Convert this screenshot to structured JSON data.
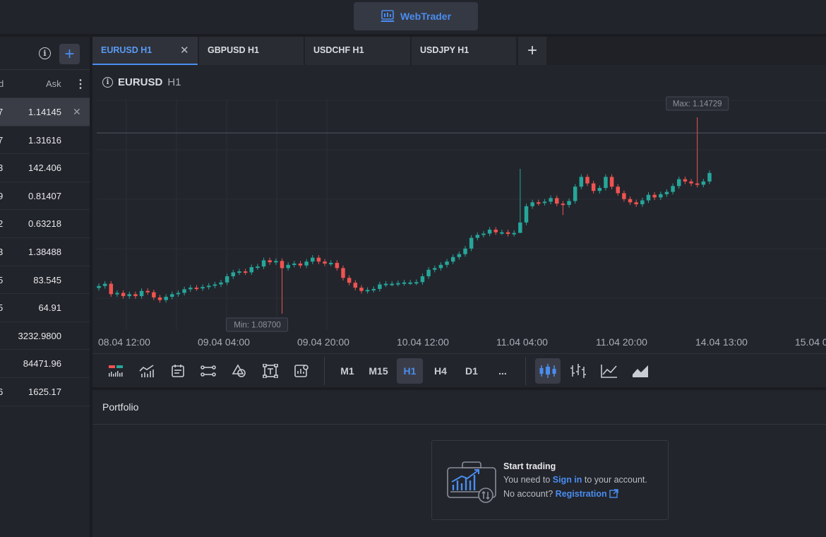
{
  "header": {
    "app_button_label": "WebTrader"
  },
  "watchlist": {
    "columns": {
      "bid": "d",
      "ask": "Ask"
    },
    "rows": [
      {
        "bid_tail": "7",
        "ask": "1.14145",
        "selected": true
      },
      {
        "bid_tail": "7",
        "ask": "1.31616"
      },
      {
        "bid_tail": "3",
        "ask": "142.406"
      },
      {
        "bid_tail": "9",
        "ask": "0.81407"
      },
      {
        "bid_tail": "2",
        "ask": "0.63218"
      },
      {
        "bid_tail": "3",
        "ask": "1.38488"
      },
      {
        "bid_tail": "5",
        "ask": "83.545"
      },
      {
        "bid_tail": "5",
        "ask": "64.91"
      },
      {
        "bid_tail": ".",
        "ask": "3232.9800"
      },
      {
        "bid_tail": ".",
        "ask": "84471.96"
      },
      {
        "bid_tail": "6",
        "ask": "1625.17"
      }
    ]
  },
  "tabs": [
    {
      "label": "EURUSD H1",
      "active": true
    },
    {
      "label": "GBPUSD H1"
    },
    {
      "label": "USDCHF H1"
    },
    {
      "label": "USDJPY H1"
    }
  ],
  "chart_header": {
    "symbol": "EURUSD",
    "timeframe": "H1"
  },
  "timeframes": [
    "M1",
    "M15",
    "H1",
    "H4",
    "D1",
    "..."
  ],
  "selected_timeframe": "H1",
  "chart_types": [
    "candlestick-icon",
    "ohlc-bars-icon",
    "line-chart-icon",
    "area-chart-icon"
  ],
  "colors": {
    "up": "#26a69a",
    "down": "#ef5350",
    "accent": "#4a8df0"
  },
  "chart_data": {
    "type": "candlestick",
    "symbol": "EURUSD",
    "timeframe": "H1",
    "x_tick_labels": [
      "08.04 12:00",
      "09.04 04:00",
      "09.04 20:00",
      "10.04 12:00",
      "11.04 04:00",
      "11.04 20:00",
      "14.04 13:00",
      "15.04 0"
    ],
    "max_label": "Max: 1.14729",
    "min_label": "Min: 1.08700",
    "max": 1.14729,
    "min": 1.087,
    "current_price_line": 1.1425,
    "close": [
      1.0955,
      1.0962,
      1.093,
      1.0934,
      1.0924,
      1.093,
      1.0924,
      1.094,
      1.0936,
      1.092,
      1.0912,
      1.0922,
      1.093,
      1.0934,
      1.0945,
      1.095,
      1.0948,
      1.0952,
      1.0956,
      1.096,
      1.0966,
      1.0985,
      1.0997,
      1.1,
      1.0997,
      1.1013,
      1.1015,
      1.1034,
      1.1028,
      1.1032,
      1.101,
      1.102,
      1.1024,
      1.1018,
      1.103,
      1.1042,
      1.103,
      1.1024,
      1.1026,
      1.101,
      1.098,
      1.0965,
      1.095,
      1.094,
      1.0943,
      1.0946,
      1.096,
      1.0962,
      1.0962,
      1.0964,
      1.0966,
      1.0966,
      1.0967,
      1.0985,
      1.1005,
      1.101,
      1.102,
      1.103,
      1.1044,
      1.1053,
      1.107,
      1.1103,
      1.1112,
      1.1116,
      1.1128,
      1.112,
      1.112,
      1.1115,
      1.1118,
      1.115,
      1.12,
      1.1212,
      1.121,
      1.1214,
      1.1225,
      1.1208,
      1.1204,
      1.1216,
      1.126,
      1.129,
      1.127,
      1.1247,
      1.1256,
      1.129,
      1.126,
      1.124,
      1.1222,
      1.1212,
      1.1206,
      1.1218,
      1.1235,
      1.1227,
      1.1237,
      1.1244,
      1.1262,
      1.1283,
      1.1276,
      1.127,
      1.1266,
      1.1276,
      1.1302
    ]
  },
  "portfolio": {
    "title": "Portfolio",
    "card_title": "Start trading",
    "line1_prefix": "You need to ",
    "line1_link": "Sign in",
    "line1_suffix": " to your account.",
    "line2_prefix": "No account? ",
    "line2_link": "Registration"
  }
}
